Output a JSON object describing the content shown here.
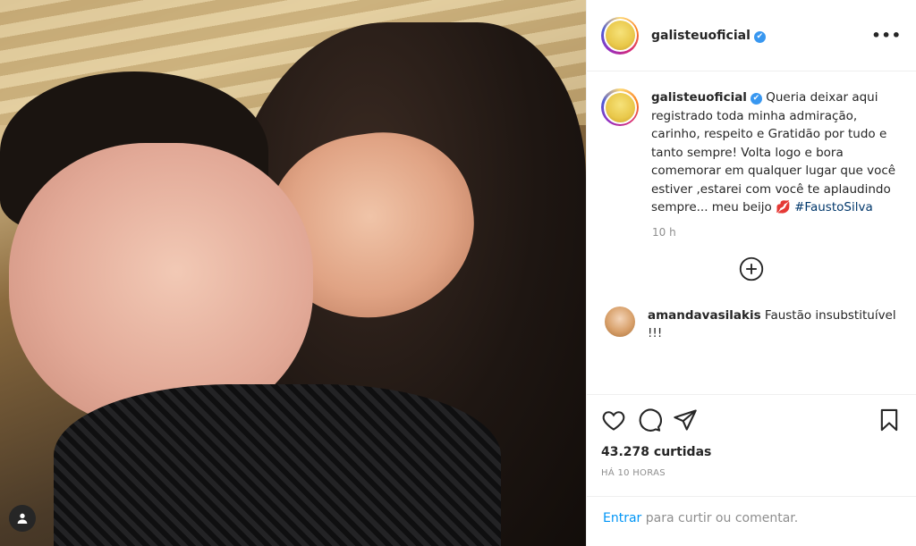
{
  "post": {
    "username": "galisteuoficial",
    "verified_mark": "✔",
    "more_label": "•••",
    "caption": {
      "username": "galisteuoficial",
      "text": "Queria deixar aqui registrado toda minha admiração, carinho, respeito e Gratidão por tudo e tanto sempre! Volta logo e bora comemorar em qualquer lugar que você estiver ,estarei com você te aplaudindo sempre... meu beijo 💋",
      "hashtag": "#FaustoSilva",
      "time": "10 h"
    },
    "comments": [
      {
        "username": "amandavasilakis",
        "text": "Faustão insubstituível !!!"
      }
    ],
    "likes": "43.278 curtidas",
    "timestamp": "HÁ 10 HORAS",
    "login": {
      "link": "Entrar",
      "text": "para curtir ou comentar."
    }
  },
  "icons": {
    "heart": "heart-icon",
    "comment": "comment-icon",
    "share": "share-icon",
    "bookmark": "bookmark-icon",
    "load_more": "plus-circle-icon",
    "user": "user-icon"
  },
  "colors": {
    "link": "#0095f6",
    "hashtag": "#00376b",
    "verified": "#3897f0",
    "muted": "#8e8e8e"
  }
}
